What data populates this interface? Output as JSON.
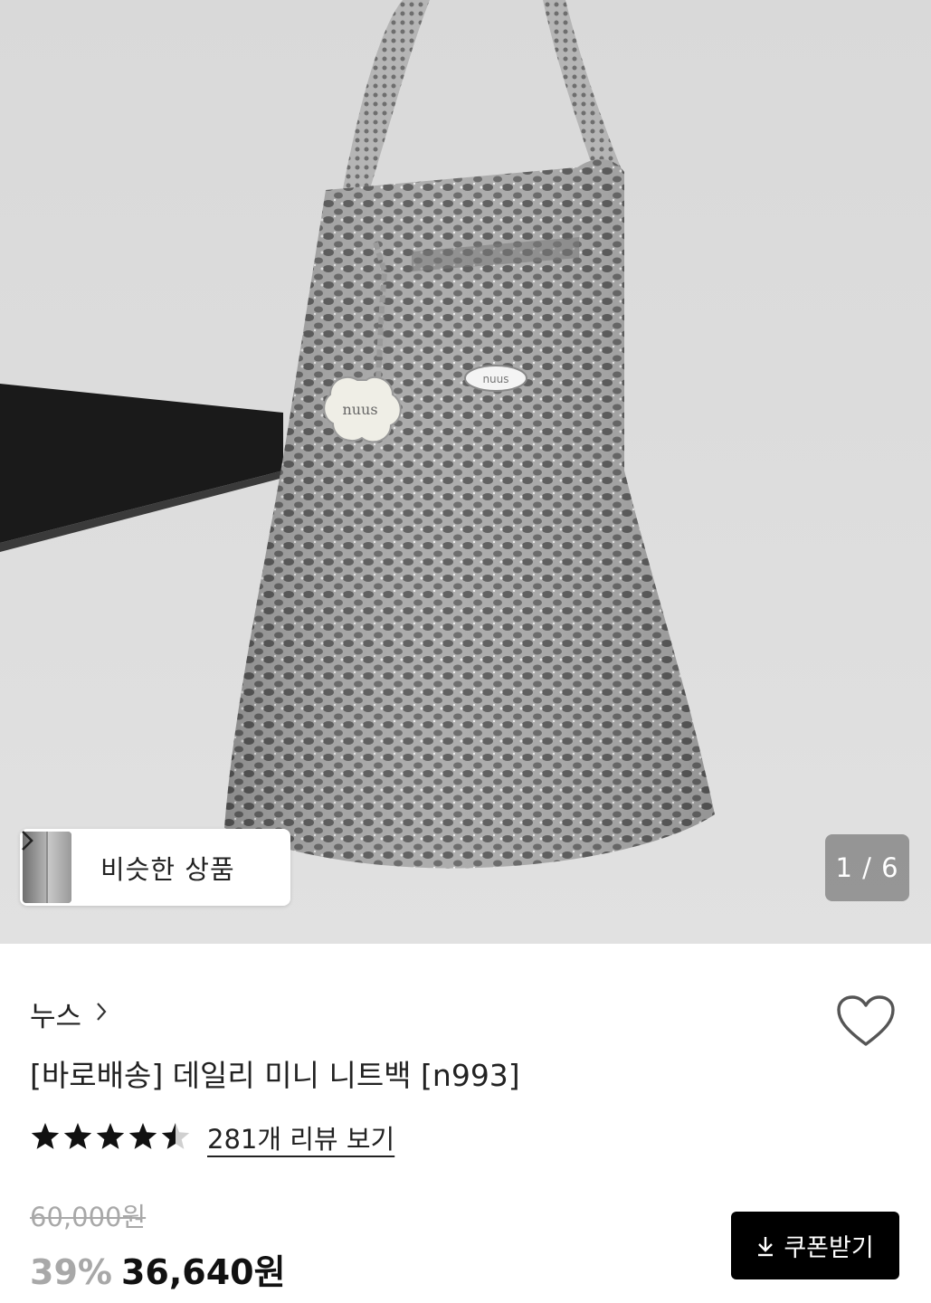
{
  "gallery": {
    "similar_label": "비슷한 상품",
    "similar_chevron": "chevron-right-icon",
    "counter": "1 / 6"
  },
  "product": {
    "brand": "누스",
    "title": "[바로배송] 데일리 미니 니트백 [n993]",
    "rating": 4.5,
    "rating_max": 5,
    "review_link": "281개 리뷰 보기",
    "original_price": "60,000원",
    "discount": "39%",
    "sale_price": "36,640원",
    "coupon_label": "쿠폰받기",
    "icons": {
      "like": "heart-outline-icon",
      "coupon": "download-icon",
      "brand": "chevron-right-icon"
    }
  },
  "colors": {
    "accent": "#000000",
    "muted_text": "#a8a8a8",
    "text": "#111111"
  }
}
